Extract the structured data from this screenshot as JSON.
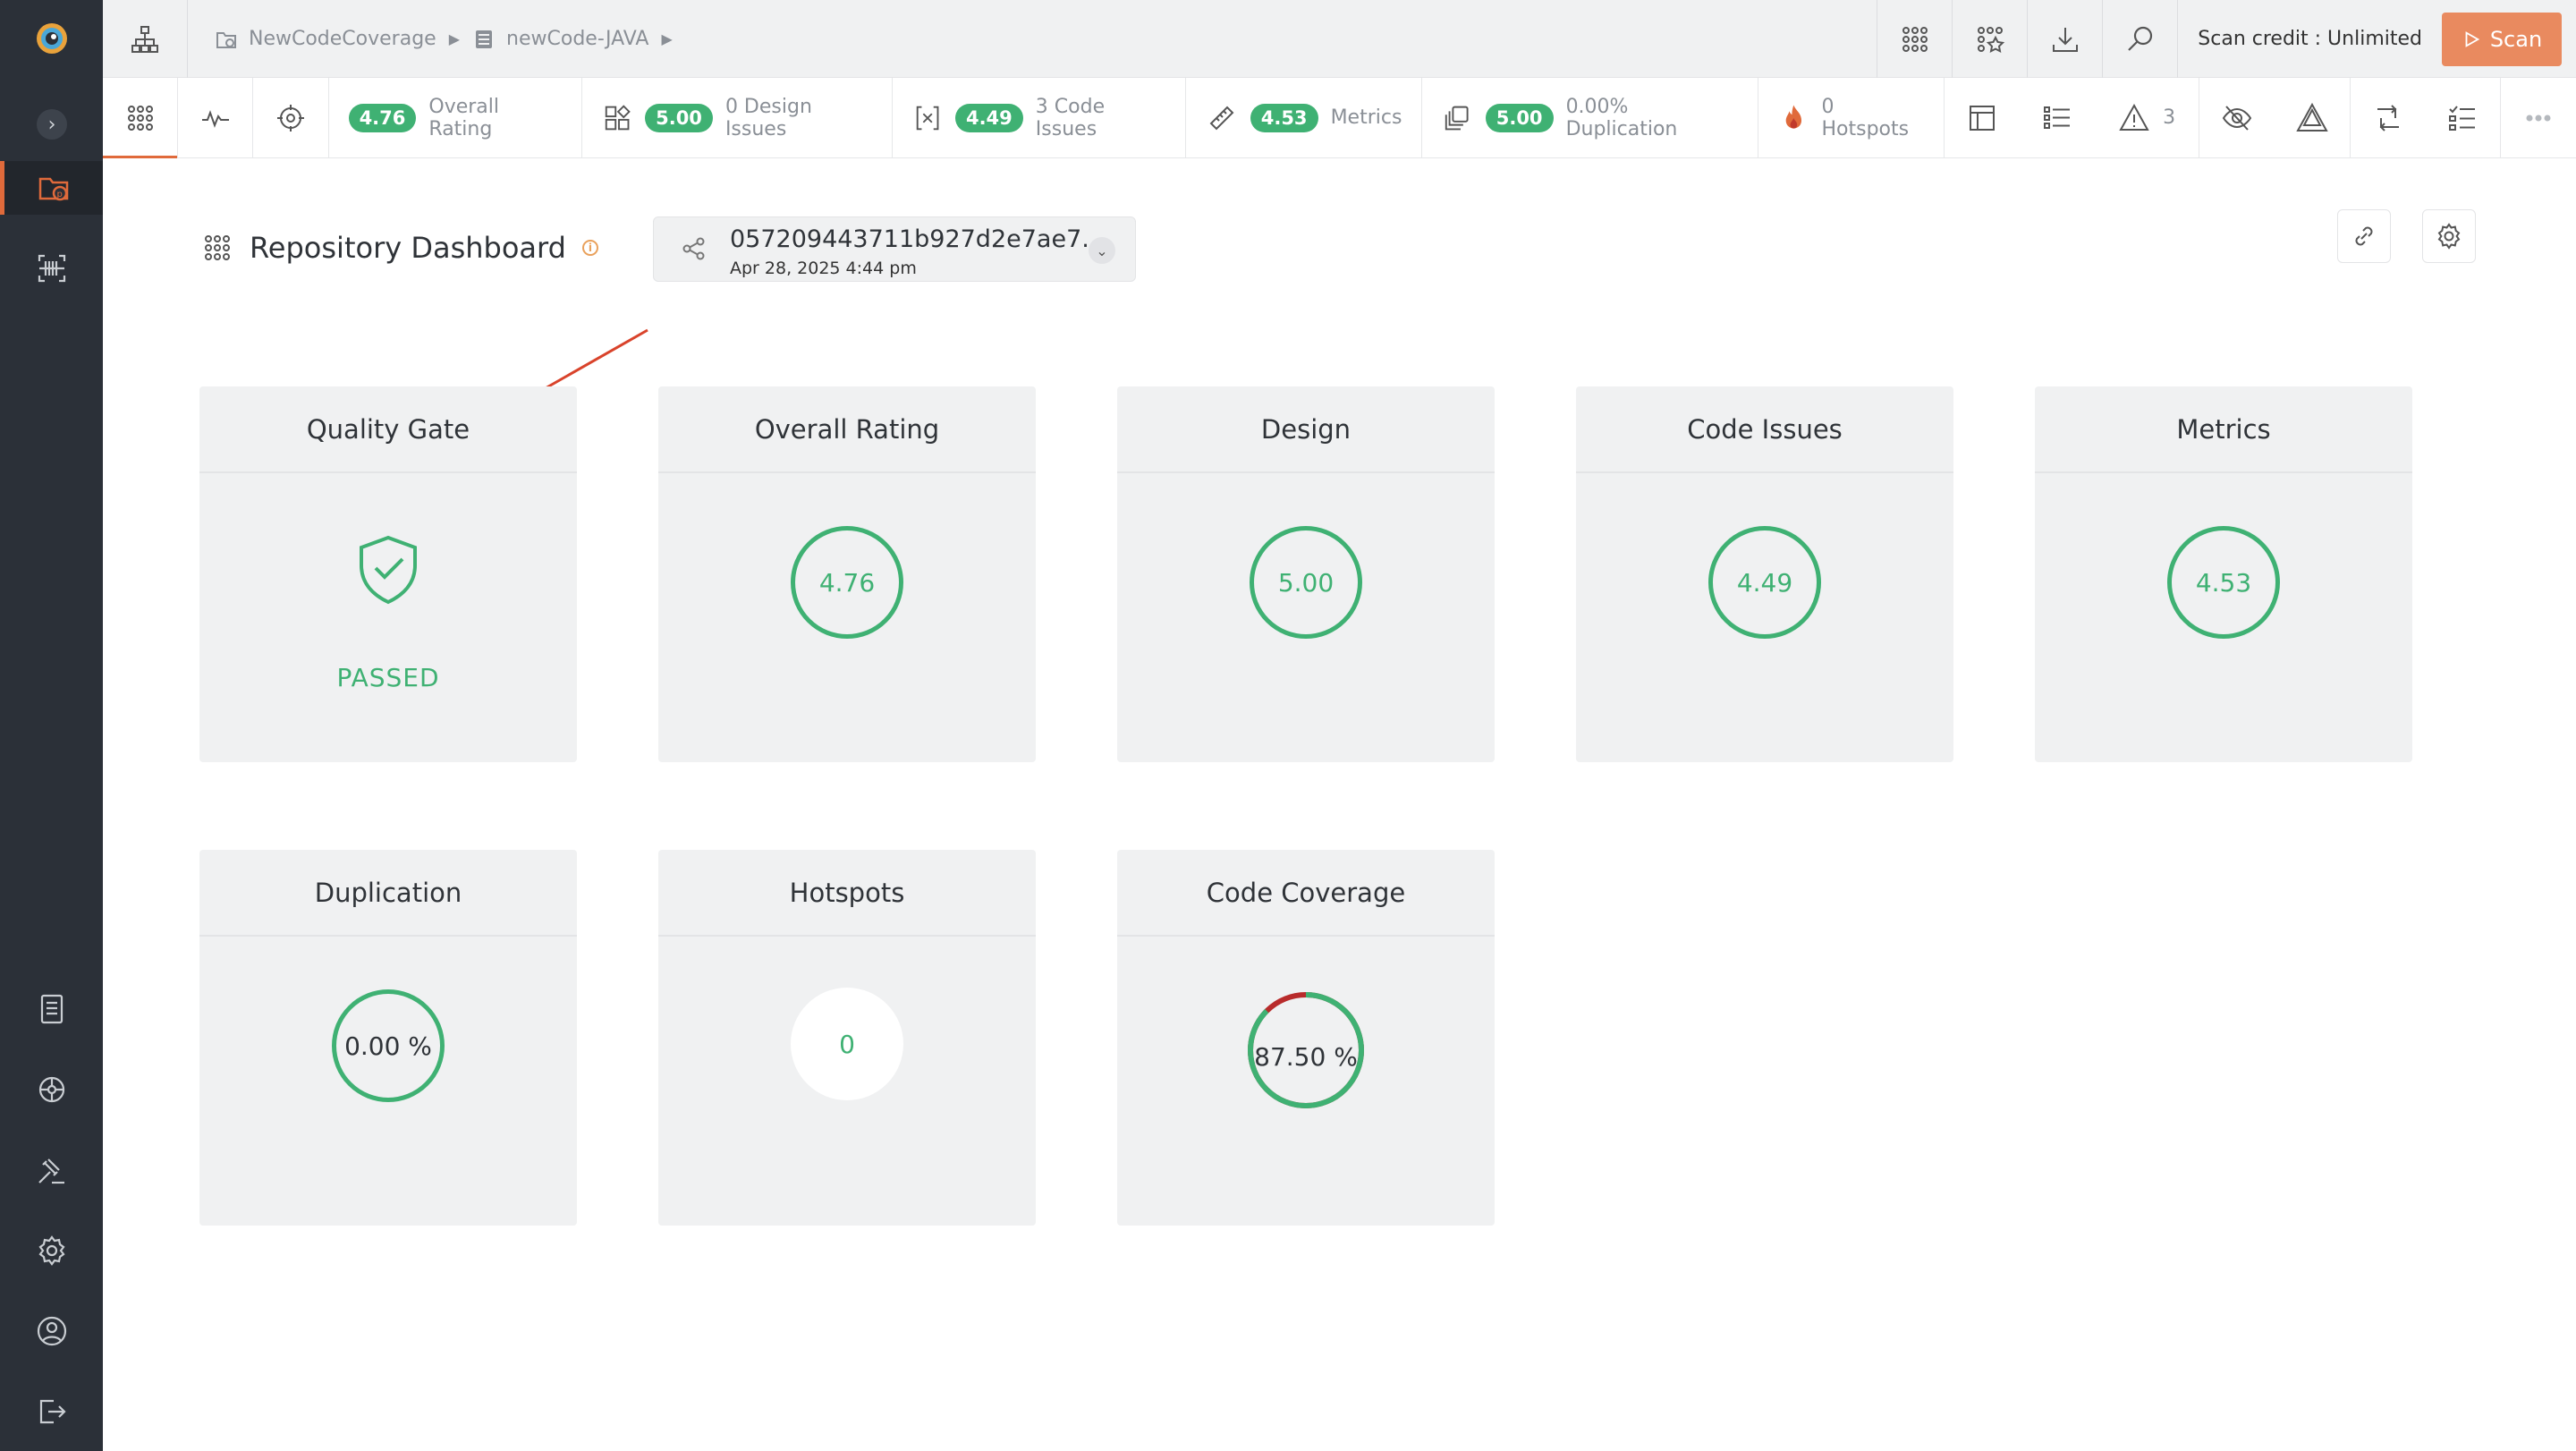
{
  "breadcrumb": {
    "project": "NewCodeCoverage",
    "repository": "newCode-JAVA"
  },
  "topbar": {
    "scan_credit": "Scan credit : Unlimited",
    "scan_label": "Scan"
  },
  "metricbar": {
    "overall_rating_value": "4.76",
    "overall_rating_label": "Overall Rating",
    "design_value": "5.00",
    "design_label": "0 Design Issues",
    "code_issues_value": "4.49",
    "code_issues_label": "3 Code Issues",
    "metrics_value": "4.53",
    "metrics_label": "Metrics",
    "duplication_value": "5.00",
    "duplication_label": "0.00% Duplication",
    "hotspots_label": "0 Hotspots",
    "warnings_count": "3"
  },
  "page": {
    "title": "Repository Dashboard",
    "info_glyph": "i",
    "commit_hash": "057209443711b927d2e7ae7...",
    "commit_date": "Apr 28, 2025    4:44 pm"
  },
  "cards": {
    "quality_gate": {
      "title": "Quality Gate",
      "status": "PASSED"
    },
    "overall_rating": {
      "title": "Overall Rating",
      "value": "4.76"
    },
    "design": {
      "title": "Design",
      "value": "5.00"
    },
    "code_issues": {
      "title": "Code Issues",
      "value": "4.49"
    },
    "metrics": {
      "title": "Metrics",
      "value": "4.53"
    },
    "duplication": {
      "title": "Duplication",
      "value": "0.00 %"
    },
    "hotspots": {
      "title": "Hotspots",
      "value": "0"
    },
    "code_coverage": {
      "title": "Code Coverage",
      "value": "87.50 %",
      "fraction": 0.875
    }
  },
  "colors": {
    "accent": "#e06a3b",
    "good": "#3fb173",
    "uncovered": "#b82b2b",
    "sidebar": "#2b3038"
  }
}
